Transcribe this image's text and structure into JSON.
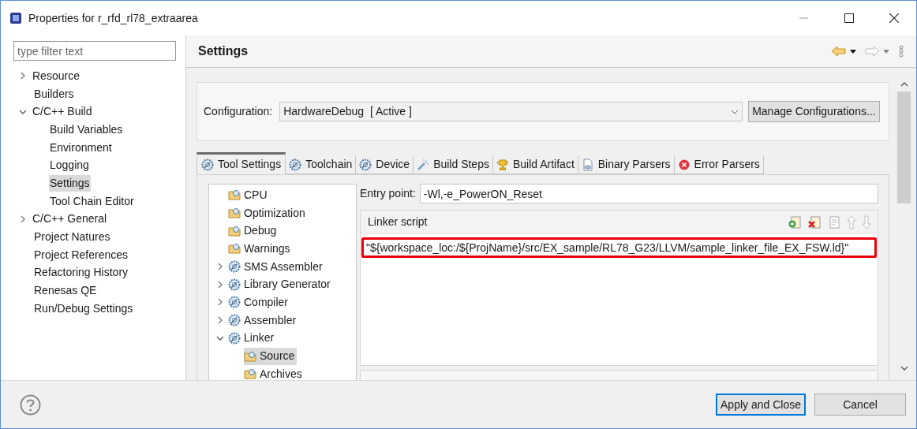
{
  "window": {
    "title": "Properties for r_rfd_rl78_extraarea"
  },
  "filter": {
    "placeholder": "type filter text"
  },
  "nav": [
    {
      "label": "Resource",
      "kind": "group",
      "expanded": false,
      "selected": false
    },
    {
      "label": "Builders",
      "kind": "item",
      "selected": false
    },
    {
      "label": "C/C++ Build",
      "kind": "group",
      "expanded": true,
      "selected": false,
      "children": [
        {
          "label": "Build Variables",
          "kind": "item",
          "selected": false
        },
        {
          "label": "Environment",
          "kind": "item",
          "selected": false
        },
        {
          "label": "Logging",
          "kind": "item",
          "selected": false
        },
        {
          "label": "Settings",
          "kind": "item",
          "selected": true
        },
        {
          "label": "Tool Chain Editor",
          "kind": "item",
          "selected": false
        }
      ]
    },
    {
      "label": "C/C++ General",
      "kind": "group",
      "expanded": false,
      "selected": false
    },
    {
      "label": "Project Natures",
      "kind": "item",
      "selected": false
    },
    {
      "label": "Project References",
      "kind": "item",
      "selected": false
    },
    {
      "label": "Refactoring History",
      "kind": "item",
      "selected": false
    },
    {
      "label": "Renesas QE",
      "kind": "item",
      "selected": false
    },
    {
      "label": "Run/Debug Settings",
      "kind": "item",
      "selected": false
    }
  ],
  "page": {
    "title": "Settings"
  },
  "configuration": {
    "label": "Configuration:",
    "value": "HardwareDebug  [ Active ]",
    "manage_button": "Manage Configurations..."
  },
  "tabs": [
    {
      "label": "Tool Settings",
      "kind": "gear",
      "selected": true
    },
    {
      "label": "Toolchain",
      "kind": "gear",
      "selected": false
    },
    {
      "label": "Device",
      "kind": "gear",
      "selected": false
    },
    {
      "label": "Build Steps",
      "kind": "steps",
      "selected": false
    },
    {
      "label": "Build Artifact",
      "kind": "trophy",
      "selected": false
    },
    {
      "label": "Binary Parsers",
      "kind": "binary",
      "selected": false
    },
    {
      "label": "Error Parsers",
      "kind": "error",
      "selected": false
    }
  ],
  "tool_tree": [
    {
      "label": "CPU",
      "kind": "folder",
      "selected": false
    },
    {
      "label": "Optimization",
      "kind": "folder",
      "selected": false
    },
    {
      "label": "Debug",
      "kind": "folder",
      "selected": false
    },
    {
      "label": "Warnings",
      "kind": "folder",
      "selected": false
    },
    {
      "label": "SMS Assembler",
      "kind": "tool",
      "expanded": false,
      "selected": false
    },
    {
      "label": "Library Generator",
      "kind": "tool",
      "expanded": false,
      "selected": false
    },
    {
      "label": "Compiler",
      "kind": "tool",
      "expanded": false,
      "selected": false
    },
    {
      "label": "Assembler",
      "kind": "tool",
      "expanded": false,
      "selected": false
    },
    {
      "label": "Linker",
      "kind": "tool",
      "expanded": true,
      "selected": false,
      "children": [
        {
          "label": "Source",
          "kind": "folder",
          "selected": true
        },
        {
          "label": "Archives",
          "kind": "folder",
          "selected": false
        }
      ]
    }
  ],
  "entry_point": {
    "label": "Entry point:",
    "value": "-Wl,-e_PowerON_Reset"
  },
  "linker_script": {
    "title": "Linker script",
    "entries": [
      {
        "text": "\"${workspace_loc:/${ProjName}/src/EX_sample/RL78_G23/LLVM/sample_linker_file_EX_FSW.ld}\"",
        "highlighted": true
      }
    ]
  },
  "buttons": [
    {
      "label": "Apply and Close",
      "default": true
    },
    {
      "label": "Cancel",
      "default": false
    }
  ]
}
